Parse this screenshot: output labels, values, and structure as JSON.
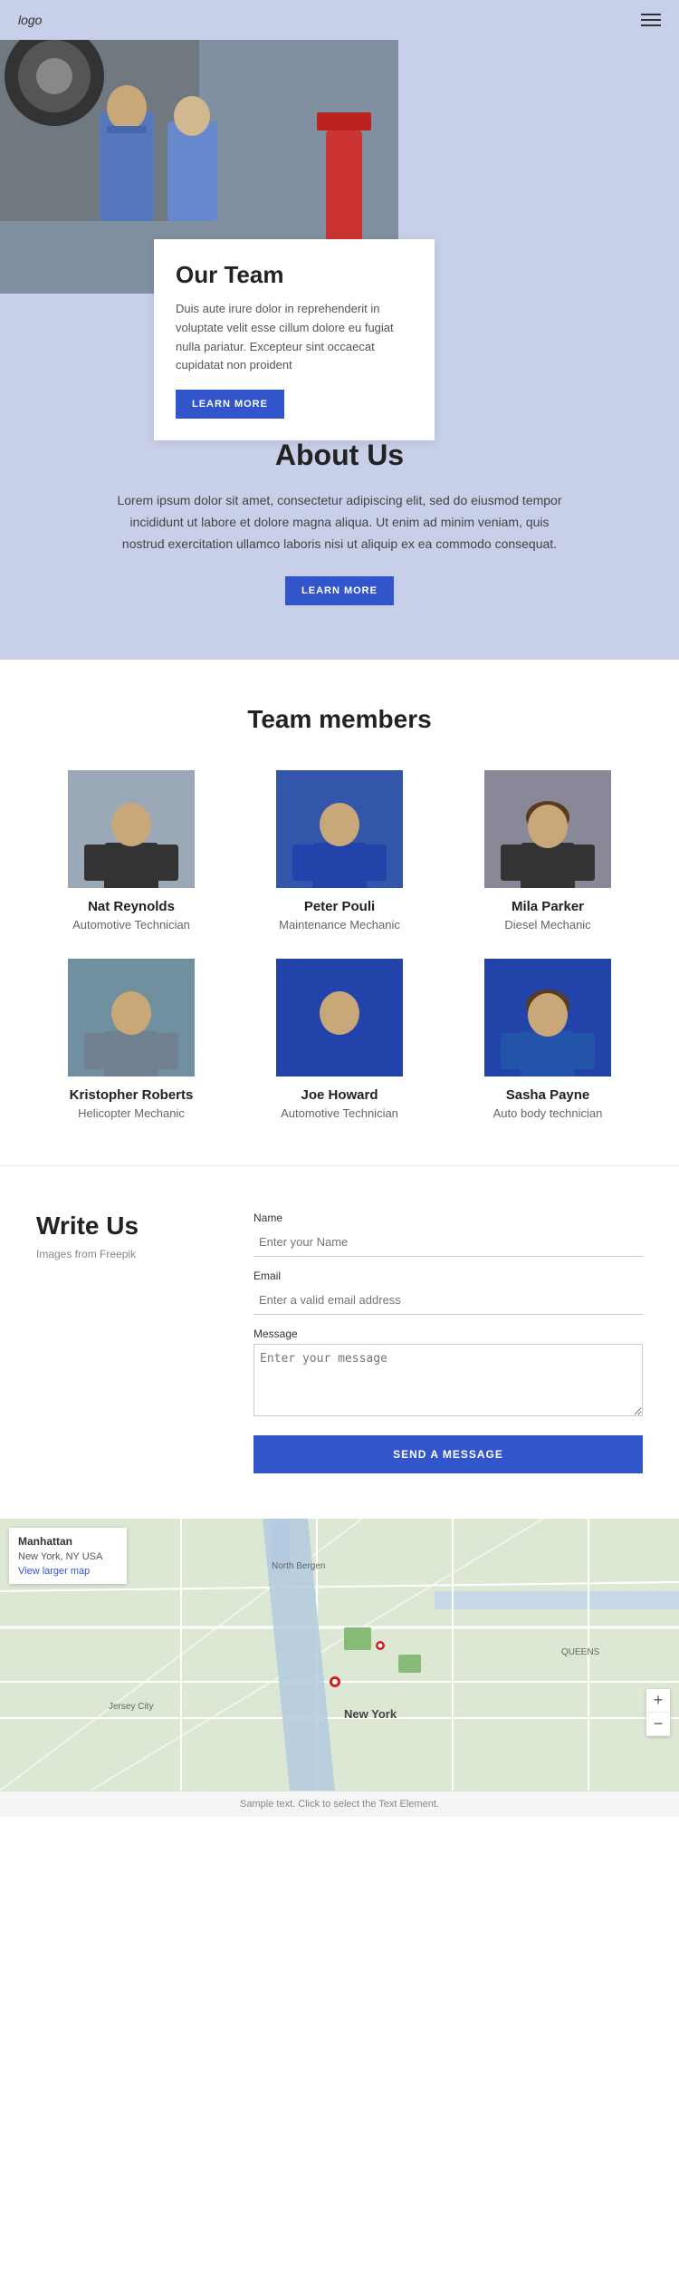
{
  "header": {
    "logo": "logo",
    "menu_icon": "≡"
  },
  "hero": {
    "title": "Our Team",
    "description": "Duis aute irure dolor in reprehenderit in voluptate velit esse cillum dolore eu fugiat nulla pariatur. Excepteur sint occaecat cupidatat non proident",
    "button_label": "LEARN MORE"
  },
  "about": {
    "title": "About Us",
    "description": "Lorem ipsum dolor sit amet, consectetur adipiscing elit, sed do eiusmod tempor incididunt ut labore et dolore magna aliqua. Ut enim ad minim veniam, quis nostrud exercitation ullamco laboris nisi ut aliquip ex ea commodo consequat.",
    "button_label": "LEARN MORE"
  },
  "team": {
    "title": "Team members",
    "members": [
      {
        "name": "Nat Reynolds",
        "role": "Automotive Technician",
        "photo_class": "photo-nat"
      },
      {
        "name": "Peter Pouli",
        "role": "Maintenance Mechanic",
        "photo_class": "photo-peter"
      },
      {
        "name": "Mila Parker",
        "role": "Diesel Mechanic",
        "photo_class": "photo-mila"
      },
      {
        "name": "Kristopher Roberts",
        "role": "Helicopter Mechanic",
        "photo_class": "photo-kris"
      },
      {
        "name": "Joe Howard",
        "role": "Automotive Technician",
        "photo_class": "photo-joe"
      },
      {
        "name": "Sasha Payne",
        "role": "Auto body technician",
        "photo_class": "photo-sasha"
      }
    ]
  },
  "contact": {
    "title": "Write Us",
    "subtitle": "Images from Freepik",
    "form": {
      "name_label": "Name",
      "name_placeholder": "Enter your Name",
      "email_label": "Email",
      "email_placeholder": "Enter a valid email address",
      "message_label": "Message",
      "message_placeholder": "Enter your message",
      "button_label": "SEND A MESSAGE"
    }
  },
  "map": {
    "panel_title": "Manhattan",
    "panel_address": "New York, NY USA",
    "panel_link": "View larger map",
    "city_label": "New York",
    "zoom_in": "+",
    "zoom_out": "−"
  },
  "bottom_bar": {
    "text": "Sample text. Click to select the Text Element."
  }
}
